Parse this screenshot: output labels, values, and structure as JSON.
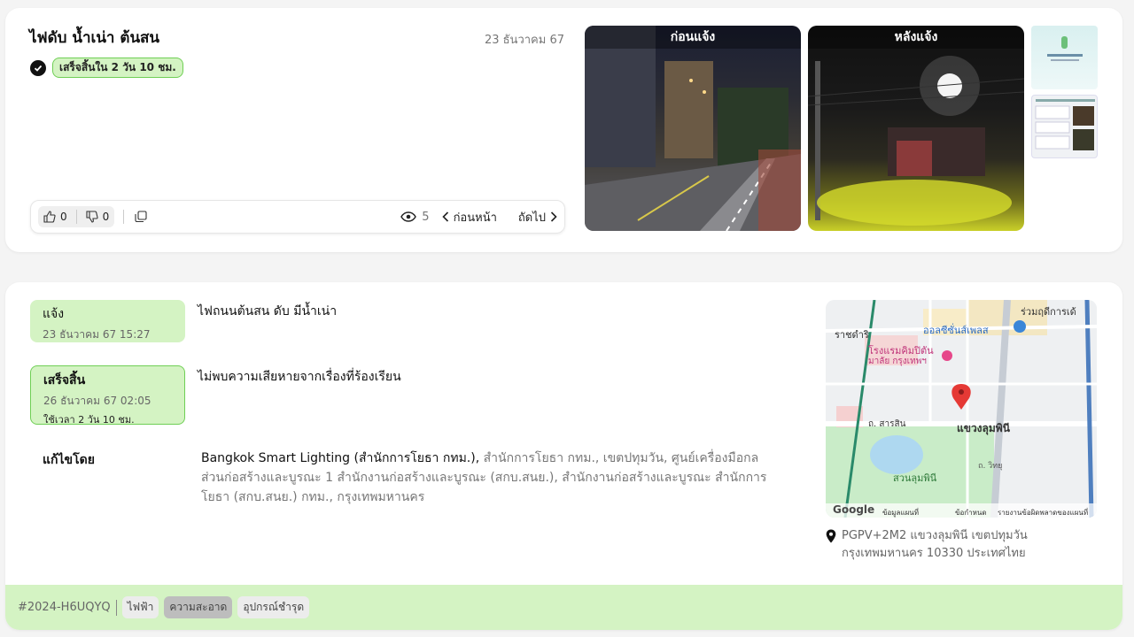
{
  "report": {
    "title": "ไฟดับ น้ำเน่า ต้นสน",
    "date": "23 ธันวาคม 67",
    "status_badge": "เสร็จสิ้นใน 2 วัน 10 ชม.",
    "likes": "0",
    "dislikes": "0",
    "views": "5",
    "prev_label": "ก่อนหน้า",
    "next_label": "ถัดไป"
  },
  "photos": {
    "before_label": "ก่อนแจ้ง",
    "after_label": "หลังแจ้ง"
  },
  "timeline": {
    "report_title": "แจ้ง",
    "report_time": "23 ธันวาคม 67 15:27",
    "report_desc": "ไฟถนนต้นสน ดับ มีน้ำเน่า",
    "done_title": "เสร็จสิ้น",
    "done_time": "26 ธันวาคม 67 02:05",
    "done_duration": "ใช้เวลา 2 วัน 10 ชม.",
    "done_desc": "ไม่พบความเสียหายจากเรื่องที่ร้องเรียน"
  },
  "fixed_by": {
    "label": "แก้ไขโดย",
    "primary": "Bangkok Smart Lighting (สำนักการโยธา กทม.),",
    "rest": "สำนักการโยธา กทม., เขตปทุมวัน, ศูนย์เครื่องมือกลส่วนก่อสร้างและบูรณะ 1 สำนักงานก่อสร้างและบูรณะ (สกบ.สนย.), สำนักงานก่อสร้างและบูรณะ สำนักการโยธา (สกบ.สนย.) กทม., กรุงเทพมหานคร"
  },
  "map": {
    "labels": {
      "rajadamri": "ราชดำริ",
      "allseasons": "ออลซีซั่นส์เพลส",
      "hotel": "โรงแรมคิมปิตัน",
      "hotel2": "มาลัย กรุงเทพฯ",
      "sarasin": "ถ. สารสิน",
      "lumphini": "แขวงลุมพินี",
      "park": "สวนลุมพินี",
      "wireless": "ถ. วิทยุ",
      "ruam": "ร่วมฤดีการเด้",
      "google": "Google",
      "mapdata": "ข้อมูลแผนที่",
      "terms": "ข้อกำหนด",
      "report": "รายงานข้อผิดพลาดของแผนที่"
    }
  },
  "address": {
    "line1": "PGPV+2M2 แขวงลุมพินี เขตปทุมวัน",
    "line2": "กรุงเทพมหานคร 10330 ประเทศไทย"
  },
  "footer": {
    "ticket_id": "#2024-H6UQYQ",
    "tags": [
      "ไฟฟ้า",
      "ความสะอาด",
      "อุปกรณ์ชำรุด"
    ]
  }
}
